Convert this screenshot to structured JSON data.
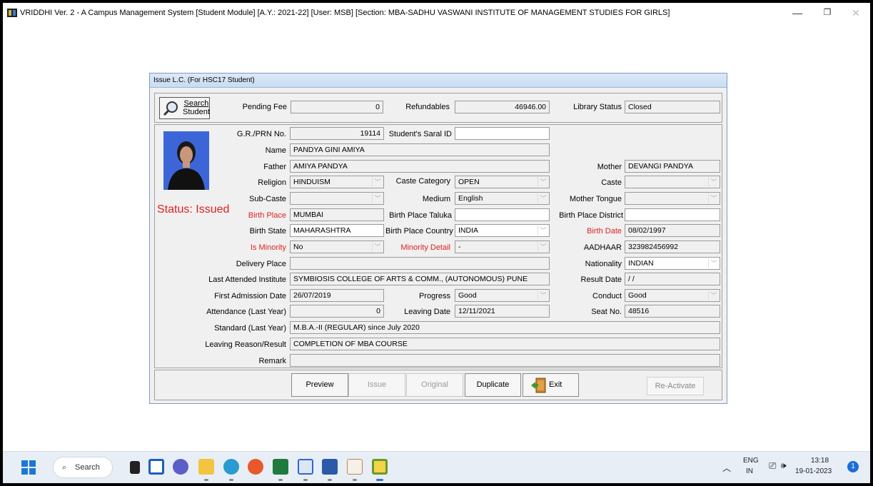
{
  "window": {
    "title": "VRIDDHI Ver. 2 - A Campus Management System [Student Module] [A.Y.: 2021-22] [User: MSB] [Section: MBA-SADHU VASWANI INSTITUTE OF MANAGEMENT STUDIES FOR GIRLS]",
    "min": "—",
    "max": "❐",
    "close": "✕"
  },
  "dialog": {
    "title": "Issue L.C. (For HSC17 Student)"
  },
  "search_button": {
    "line1": "Search",
    "line2": "Student"
  },
  "top": {
    "pending_fee_label": "Pending Fee",
    "pending_fee": "0",
    "refundables_label": "Refundables",
    "refundables": "46946.00",
    "library_label": "Library Status",
    "library": "Closed"
  },
  "status": "Status: Issued",
  "fields": {
    "gr_label": "G.R./PRN No.",
    "gr": "19114",
    "saral_label": "Student's Saral ID",
    "saral": "",
    "name_label": "Name",
    "name": "PANDYA GINI AMIYA",
    "father_label": "Father",
    "father": "AMIYA PANDYA",
    "mother_label": "Mother",
    "mother": "DEVANGI PANDYA",
    "religion_label": "Religion",
    "religion": "HINDUISM",
    "caste_cat_label": "Caste Category",
    "caste_cat": "OPEN",
    "caste_label": "Caste",
    "caste": "",
    "subcaste_label": "Sub-Caste",
    "subcaste": "",
    "medium_label": "Medium",
    "medium": "English",
    "tongue_label": "Mother Tongue",
    "tongue": "",
    "bplace_label": "Birth Place",
    "bplace": "MUMBAI",
    "btaluka_label": "Birth Place Taluka",
    "btaluka": "",
    "bdistrict_label": "Birth Place District",
    "bdistrict": "",
    "bstate_label": "Birth State",
    "bstate": "MAHARASHTRA",
    "bcountry_label": "Birth Place Country",
    "bcountry": "INDIA",
    "bdate_label": "Birth Date",
    "bdate": "08/02/1997",
    "minority_label": "Is Minority",
    "minority": "No",
    "minority_detail_label": "Minority Detail",
    "minority_detail": "-",
    "aadhaar_label": "AADHAAR",
    "aadhaar": "323982456992",
    "delivery_label": "Delivery Place",
    "delivery": "",
    "nationality_label": "Nationality",
    "nationality": "INDIAN",
    "last_inst_label": "Last Attended Institute",
    "last_inst": "SYMBIOSIS COLLEGE OF ARTS & COMM., (AUTONOMOUS) PUNE",
    "result_date_label": "Result Date",
    "result_date": "/ /",
    "first_adm_label": "First Admission Date",
    "first_adm": "26/07/2019",
    "progress_label": "Progress",
    "progress": "Good",
    "conduct_label": "Conduct",
    "conduct": "Good",
    "attendance_label": "Attendance (Last Year)",
    "attendance": "0",
    "leaving_date_label": "Leaving Date",
    "leaving_date": "12/11/2021",
    "seat_label": "Seat No.",
    "seat": "48516",
    "standard_label": "Standard (Last Year)",
    "standard": "M.B.A.-II (REGULAR) since July 2020",
    "reason_label": "Leaving Reason/Result",
    "reason": "COMPLETION OF MBA COURSE",
    "remark_label": "Remark",
    "remark": ""
  },
  "buttons": {
    "preview": "Preview",
    "issue": "Issue",
    "original": "Original",
    "duplicate": "Duplicate",
    "exit": "Exit",
    "reactivate": "Re-Activate"
  },
  "taskbar": {
    "search": "Search",
    "lang1": "ENG",
    "lang2": "IN",
    "time": "13:18",
    "date": "19-01-2023",
    "notif": "1"
  }
}
